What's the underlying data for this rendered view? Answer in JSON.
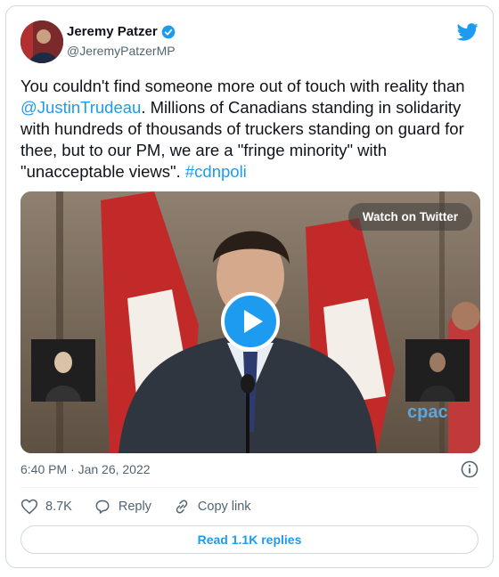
{
  "author": {
    "name": "Jeremy Patzer",
    "handle": "@JeremyPatzerMP",
    "verified": true
  },
  "tweet": {
    "text_1": "You couldn't find someone more out of touch with reality than ",
    "mention": "@JustinTrudeau",
    "text_2": ". Millions of Canadians standing in solidarity with hundreds of thousands of truckers standing on guard for thee, but to our PM, we are a \"fringe minority\" with \"unacceptable views\". ",
    "hashtag": "#cdnpoli"
  },
  "media": {
    "watch_label": "Watch on Twitter",
    "overlay_text": "cpac"
  },
  "meta": {
    "timestamp": "6:40 PM · Jan 26, 2022"
  },
  "actions": {
    "likes": "8.7K",
    "reply_label": "Reply",
    "copy_label": "Copy link"
  },
  "replies_label": "Read 1.1K replies",
  "colors": {
    "accent": "#1d9bf0",
    "text": "#0f1419",
    "secondary": "#536471",
    "border": "#cfd9de"
  },
  "icons": {
    "platform": "twitter-bird-icon",
    "verified": "verified-badge-icon",
    "info": "info-icon",
    "like": "heart-icon",
    "reply": "reply-bubble-icon",
    "copy": "link-icon",
    "play": "play-icon"
  }
}
